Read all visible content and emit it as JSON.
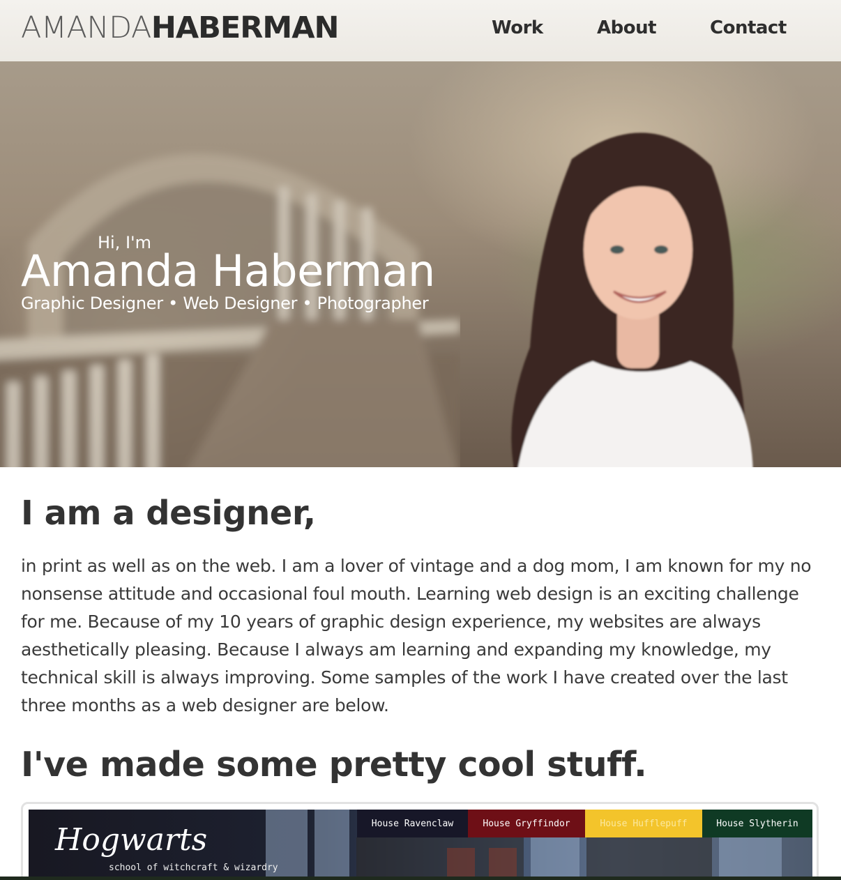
{
  "header": {
    "logo_light": "AMANDA",
    "logo_bold": "HABERMAN",
    "nav": {
      "work": "Work",
      "about": "About",
      "contact": "Contact"
    }
  },
  "hero": {
    "greeting": "Hi, I'm",
    "name": "Amanda Haberman",
    "subtitle": "Graphic Designer • Web Designer • Photographer"
  },
  "main": {
    "heading_designer": "I am a designer,",
    "intro": "in print as well as on the web. I am a lover of vintage and a dog mom, I am known for my no nonsense attitude and occasional foul mouth. Learning web design is an exciting challenge for me. Because of my 10 years of graphic design experience, my websites are always aesthetically pleasing. Because I always am learning and expanding my knowledge, my technical skill is always improving. Some samples of the work I have created over the last three months as a web designer are below.",
    "heading_work": "I've made some pretty cool stuff."
  },
  "project": {
    "logo": "Hogwarts",
    "tagline": "school of witchcraft & wizardry",
    "houses": [
      "House Ravenclaw",
      "House Gryffindor",
      "House Hufflepuff",
      "House Slytherin"
    ],
    "house_colors": [
      "#171728",
      "#6e0f16",
      "#f3c42b",
      "#0f3a24"
    ]
  }
}
